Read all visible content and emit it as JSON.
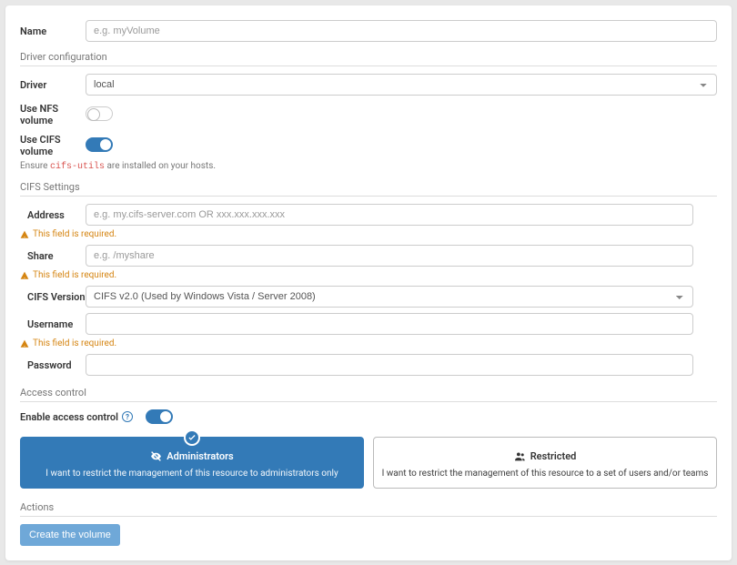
{
  "name": {
    "label": "Name",
    "placeholder": "e.g. myVolume"
  },
  "sections": {
    "driver_config": "Driver configuration",
    "cifs_settings": "CIFS Settings",
    "access_control": "Access control",
    "actions": "Actions"
  },
  "driver": {
    "label": "Driver",
    "value": "local"
  },
  "nfs": {
    "label": "Use NFS volume",
    "on": false
  },
  "cifs": {
    "label": "Use CIFS volume",
    "on": true,
    "hint_prefix": "Ensure ",
    "hint_code": "cifs-utils",
    "hint_suffix": " are installed on your hosts."
  },
  "cifs_fields": {
    "address": {
      "label": "Address",
      "placeholder": "e.g. my.cifs-server.com OR xxx.xxx.xxx.xxx"
    },
    "share": {
      "label": "Share",
      "placeholder": "e.g. /myshare"
    },
    "version": {
      "label": "CIFS Version",
      "value": "CIFS v2.0 (Used by Windows Vista / Server 2008)"
    },
    "username": {
      "label": "Username"
    },
    "password": {
      "label": "Password"
    }
  },
  "errors": {
    "required": "This field is required."
  },
  "access": {
    "enable_label": "Enable access control",
    "on": true,
    "admin": {
      "title": "Administrators",
      "desc": "I want to restrict the management of this resource to administrators only"
    },
    "restricted": {
      "title": "Restricted",
      "desc": "I want to restrict the management of this resource to a set of users and/or teams"
    }
  },
  "actions": {
    "create": "Create the volume"
  }
}
